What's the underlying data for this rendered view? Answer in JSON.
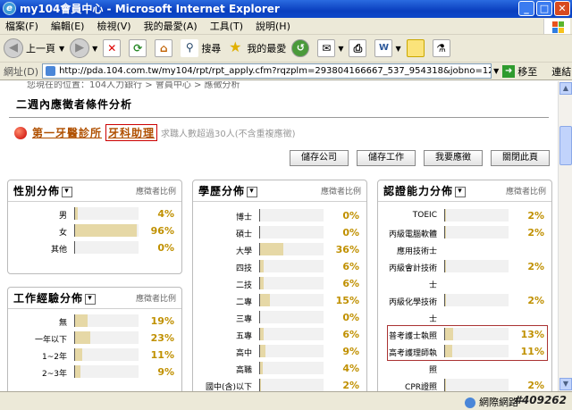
{
  "window": {
    "title": "my104會員中心 - Microsoft Internet Explorer"
  },
  "menu": [
    "檔案(F)",
    "編輯(E)",
    "檢視(V)",
    "我的最愛(A)",
    "工具(T)",
    "說明(H)"
  ],
  "toolbar": {
    "back": "上一頁",
    "search": "搜尋",
    "favorites": "我的最愛"
  },
  "address": {
    "label": "網址(D)",
    "url": "http://pda.104.com.tw/my104/rpt/rpt_apply.cfm?rqzplm=293804166667_537_954318&jobno=1247458&custno=2025379800",
    "go": "移至",
    "links": "連結"
  },
  "breadcrumb": "您現在的位置：104人力銀行 > 會員中心 > 應徵分析",
  "page": {
    "heading": "二週內應徵者條件分析",
    "company": "第一牙醫診所",
    "job": "牙科助理",
    "note": "求職人數超過30人(不含重複應徵)",
    "buttons": [
      "儲存公司",
      "儲存工作",
      "我要應徵",
      "關閉此頁"
    ]
  },
  "panels": {
    "gender": {
      "title": "性別分佈",
      "sub": "應徵者比例",
      "rows": [
        {
          "label": "男",
          "pct": "4%",
          "value": 4
        },
        {
          "label": "女",
          "pct": "96%",
          "value": 96
        },
        {
          "label": "其他",
          "pct": "0%",
          "value": 0
        }
      ]
    },
    "experience": {
      "title": "工作經驗分佈",
      "sub": "應徵者比例",
      "rows": [
        {
          "label": "無",
          "pct": "19%",
          "value": 19
        },
        {
          "label": "一年以下",
          "pct": "23%",
          "value": 23
        },
        {
          "label": "1~2年",
          "pct": "11%",
          "value": 11
        },
        {
          "label": "2~3年",
          "pct": "9%",
          "value": 9
        }
      ]
    },
    "education": {
      "title": "學歷分佈",
      "sub": "應徵者比例",
      "rows": [
        {
          "label": "博士",
          "pct": "0%",
          "value": 0
        },
        {
          "label": "碩士",
          "pct": "0%",
          "value": 0
        },
        {
          "label": "大學",
          "pct": "36%",
          "value": 36
        },
        {
          "label": "四技",
          "pct": "6%",
          "value": 6
        },
        {
          "label": "二技",
          "pct": "6%",
          "value": 6
        },
        {
          "label": "二專",
          "pct": "15%",
          "value": 15
        },
        {
          "label": "三專",
          "pct": "0%",
          "value": 0
        },
        {
          "label": "五專",
          "pct": "6%",
          "value": 6
        },
        {
          "label": "高中",
          "pct": "9%",
          "value": 9
        },
        {
          "label": "高職",
          "pct": "4%",
          "value": 4
        },
        {
          "label": "國中(含)以下",
          "pct": "2%",
          "value": 2
        }
      ]
    },
    "cert": {
      "title": "認證能力分佈",
      "sub": "應徵者比例",
      "rows": [
        {
          "label": "TOEIC",
          "pct": "2%",
          "value": 2
        },
        {
          "label": "丙級電腦軟體",
          "pct": "2%",
          "value": 2
        },
        {
          "label": "應用技術士",
          "pct": "",
          "value": null
        },
        {
          "label": "丙級會計技術",
          "pct": "2%",
          "value": 2
        },
        {
          "label": "士",
          "pct": "",
          "value": null
        },
        {
          "label": "丙級化學技術",
          "pct": "2%",
          "value": 2
        },
        {
          "label": "士",
          "pct": "",
          "value": null
        },
        {
          "label": "普考護士執照",
          "pct": "13%",
          "value": 13
        },
        {
          "label": "高考護理師執",
          "pct": "11%",
          "value": 11
        },
        {
          "label": "照",
          "pct": "",
          "value": null
        },
        {
          "label": "CPR證照",
          "pct": "2%",
          "value": 2
        }
      ]
    }
  },
  "status": {
    "zone": "網際網路",
    "watermark": "#409262"
  }
}
